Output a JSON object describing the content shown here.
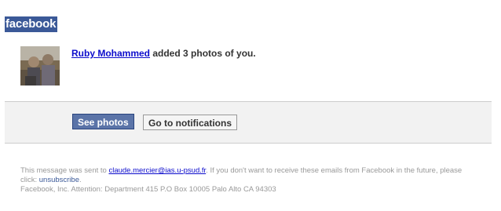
{
  "brand": {
    "logo_text": "facebook"
  },
  "notification": {
    "actor_name": "Ruby Mohammed",
    "message_rest": " added 3 photos of you."
  },
  "actions": {
    "primary_label": "See photos",
    "secondary_label": "Go to notifications"
  },
  "footer": {
    "sent_prefix": "This message was sent to ",
    "email": "claude.mercier@ias.u-psud.fr",
    "opt_out_text": ". If you don't want to receive these emails from Facebook in the future, please click: ",
    "unsubscribe_label": "unsubscribe",
    "address_line": "Facebook, Inc. Attention: Department 415 P.O Box 10005 Palo Alto CA 94303"
  },
  "colors": {
    "brand_blue": "#3b5998",
    "link_blue": "#0c0ccc",
    "bar_bg": "#f2f2f2"
  }
}
